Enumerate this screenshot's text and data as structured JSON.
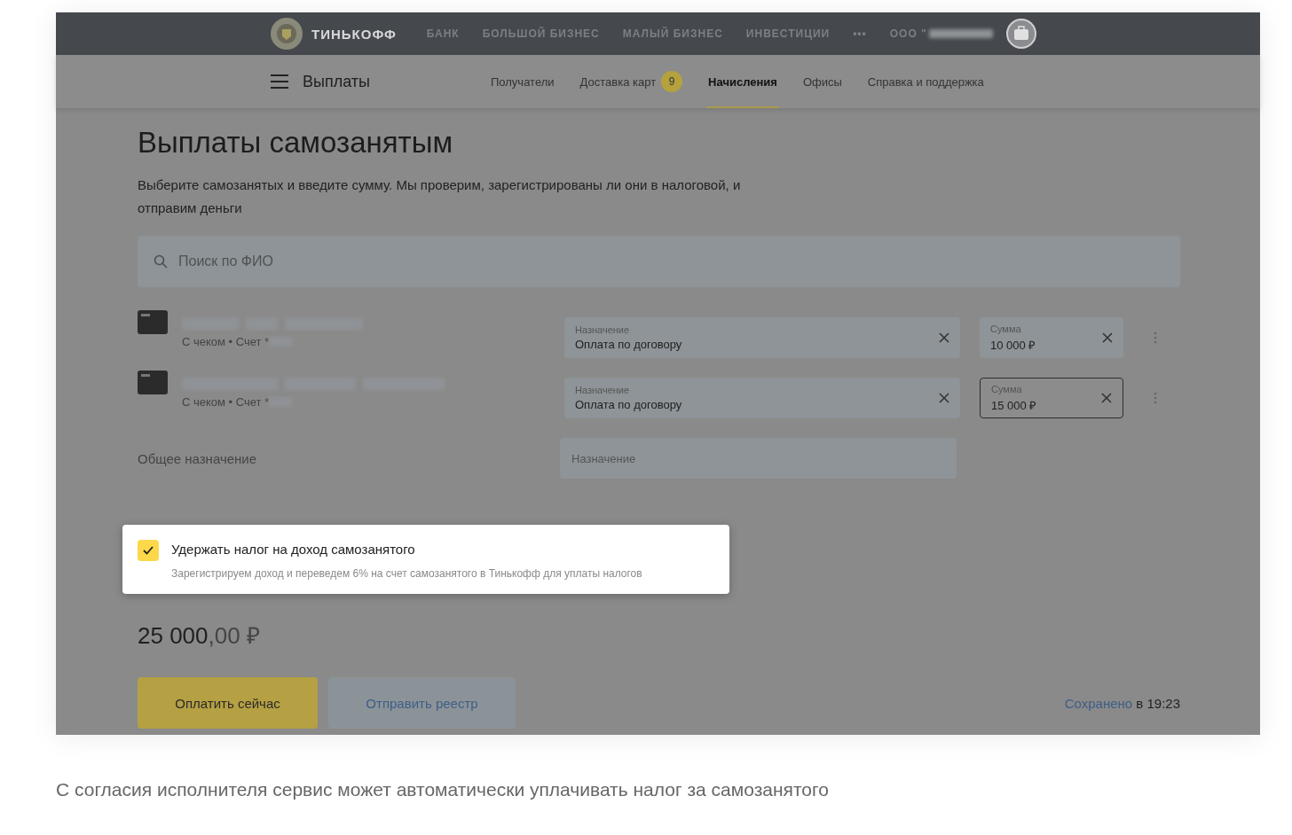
{
  "header": {
    "logo_text": "ТИНЬКОФФ",
    "links": [
      "БАНК",
      "БОЛЬШОЙ БИЗНЕС",
      "МАЛЫЙ БИЗНЕС",
      "ИНВЕСТИЦИИ"
    ],
    "more": "•••",
    "org": "ООО \""
  },
  "nav": {
    "title": "Выплаты",
    "tabs": [
      {
        "label": "Получатели",
        "selected": false
      },
      {
        "label": "Доставка карт",
        "badge": "9",
        "selected": false
      },
      {
        "label": "Начисления",
        "selected": true
      },
      {
        "label": "Офисы",
        "selected": false
      },
      {
        "label": "Справка и поддержка",
        "selected": false
      }
    ]
  },
  "page": {
    "title": "Выплаты самозанятым",
    "description": "Выберите самозанятых и введите сумму. Мы проверим, зарегистрированы ли они в налоговой, и отправим деньги",
    "search": {
      "placeholder": "Поиск по ФИО"
    },
    "recipients": [
      {
        "detail": "С чеком • Счет *",
        "purpose": {
          "label": "Назначение",
          "value": "Оплата по договору"
        },
        "sum": {
          "label": "Сумма",
          "value": "10 000 ₽",
          "focused": false
        }
      },
      {
        "detail": "С чеком • Счет *",
        "purpose": {
          "label": "Назначение",
          "value": "Оплата по договору"
        },
        "sum": {
          "label": "Сумма",
          "value": "15 000 ₽",
          "focused": true
        }
      }
    ],
    "general_purpose": {
      "label": "Общее назначение",
      "placeholder": "Назначение"
    },
    "tax_option": {
      "checked": true,
      "title": "Удержать налог на доход самозанятого",
      "hint": "Зарегистрируем доход и переведем 6% на счет самозанятого в Тинькофф для уплаты налогов"
    },
    "total": {
      "main": "25 000",
      "fraction": ",00 ₽"
    },
    "buttons": [
      {
        "label": "Оплатить сейчас",
        "kind": "primary"
      },
      {
        "label": "Отправить реестр",
        "kind": "secondary"
      }
    ],
    "saved": {
      "link": "Сохранено",
      "rest": "в 19:23"
    }
  },
  "caption": "С согласия исполнителя сервис может автоматически уплачивать налог за самозанятого"
}
